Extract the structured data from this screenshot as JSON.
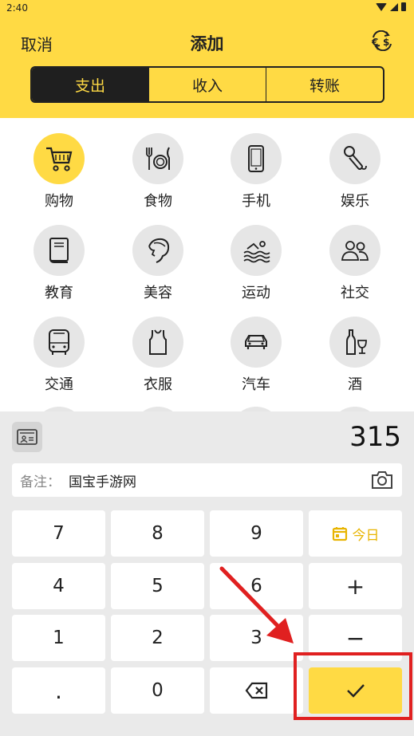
{
  "status": {
    "time": "2:40"
  },
  "header": {
    "cancel": "取消",
    "title": "添加",
    "currency_icon": "currency-exchange-icon"
  },
  "tabs": [
    {
      "label": "支出",
      "active": true
    },
    {
      "label": "收入",
      "active": false
    },
    {
      "label": "转账",
      "active": false
    }
  ],
  "categories": [
    {
      "label": "购物",
      "icon": "shopping-cart-icon",
      "active": true
    },
    {
      "label": "食物",
      "icon": "food-icon"
    },
    {
      "label": "手机",
      "icon": "phone-icon"
    },
    {
      "label": "娱乐",
      "icon": "microphone-icon"
    },
    {
      "label": "教育",
      "icon": "book-icon"
    },
    {
      "label": "美容",
      "icon": "beauty-icon"
    },
    {
      "label": "运动",
      "icon": "swim-icon"
    },
    {
      "label": "社交",
      "icon": "people-icon"
    },
    {
      "label": "交通",
      "icon": "bus-icon"
    },
    {
      "label": "衣服",
      "icon": "shirt-icon"
    },
    {
      "label": "汽车",
      "icon": "car-icon"
    },
    {
      "label": "酒",
      "icon": "wine-icon"
    }
  ],
  "keyboard": {
    "amount": "315",
    "note_label": "备注：",
    "note_text": "国宝手游网",
    "keys": {
      "k7": "7",
      "k8": "8",
      "k9": "9",
      "today": "今日",
      "k4": "4",
      "k5": "5",
      "k6": "6",
      "plus": "+",
      "k1": "1",
      "k2": "2",
      "k3": "3",
      "minus": "−",
      "dot": ".",
      "k0": "0"
    }
  },
  "colors": {
    "accent": "#FFDA44",
    "dark": "#1F1F1F",
    "annotation": "#E02020"
  }
}
